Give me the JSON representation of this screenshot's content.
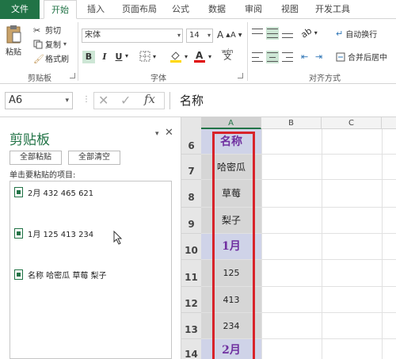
{
  "ribbon_tabs": [
    "文件",
    "开始",
    "插入",
    "页面布局",
    "公式",
    "数据",
    "审阅",
    "视图",
    "开发工具"
  ],
  "clipboard_group": {
    "paste_label": "粘贴",
    "cut_label": "剪切",
    "copy_label": "复制",
    "format_painter_label": "格式刷",
    "group_label": "剪贴板"
  },
  "font_group": {
    "font_name": "宋体",
    "font_size": "14",
    "group_label": "字体",
    "bold": "B",
    "italic": "I",
    "underline": "U",
    "grow_font": "A",
    "shrink_font": "A",
    "phonetic": "wén"
  },
  "alignment_group": {
    "wrap_text_label": "自动换行",
    "merge_center_label": "合并后居中",
    "group_label": "对齐方式"
  },
  "formula_bar": {
    "name_box": "A6",
    "fx": "fx",
    "value": "名称"
  },
  "clipboard_pane": {
    "title": "剪贴板",
    "paste_all_label": "全部粘贴",
    "clear_all_label": "全部清空",
    "hint": "单击要粘贴的项目:",
    "items": [
      "2月 432 465 621",
      "1月 125 413 234",
      "名称 哈密瓜 草莓 梨子"
    ]
  },
  "sheet": {
    "columns": [
      "A",
      "B",
      "C"
    ],
    "rows": [
      {
        "num": "6",
        "a": "名称",
        "style": "header"
      },
      {
        "num": "7",
        "a": "哈密瓜",
        "style": "text"
      },
      {
        "num": "8",
        "a": "草莓",
        "style": "text"
      },
      {
        "num": "9",
        "a": "梨子",
        "style": "text"
      },
      {
        "num": "10",
        "a": "1月",
        "style": "header"
      },
      {
        "num": "11",
        "a": "125",
        "style": "num"
      },
      {
        "num": "12",
        "a": "413",
        "style": "num"
      },
      {
        "num": "13",
        "a": "234",
        "style": "num"
      },
      {
        "num": "14",
        "a": "2月",
        "style": "header"
      }
    ]
  },
  "colors": {
    "accent": "#217346",
    "header_fill": "#cfd3e8",
    "header_text": "#7030a0",
    "selection_fill": "#d6d6d6",
    "red_outline": "#d8232a"
  }
}
